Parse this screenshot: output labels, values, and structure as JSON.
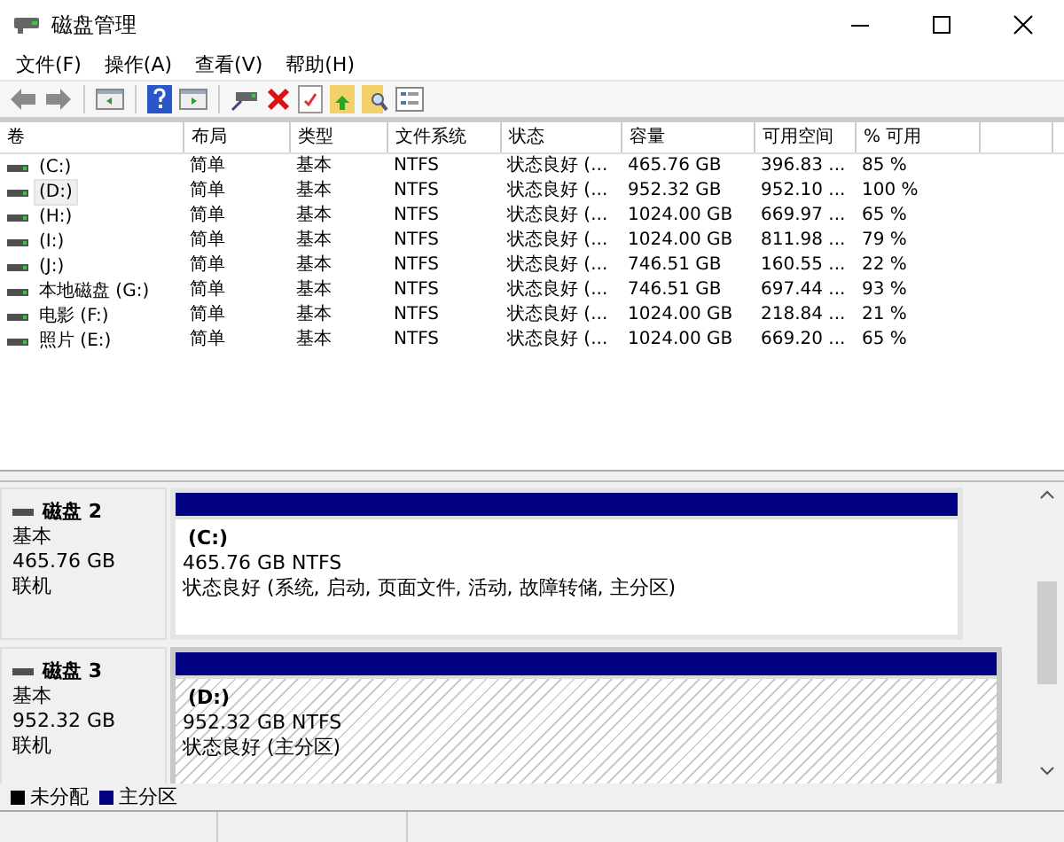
{
  "window": {
    "title": "磁盘管理"
  },
  "menu": [
    "文件(F)",
    "操作(A)",
    "查看(V)",
    "帮助(H)"
  ],
  "table": {
    "columns": [
      "卷",
      "布局",
      "类型",
      "文件系统",
      "状态",
      "容量",
      "可用空间",
      "% 可用"
    ],
    "rows": [
      {
        "cells": [
          "(C:)",
          "简单",
          "基本",
          "NTFS",
          "状态良好 (...",
          "465.76 GB",
          "396.83 ...",
          "85 %"
        ],
        "selected": false
      },
      {
        "cells": [
          "(D:)",
          "简单",
          "基本",
          "NTFS",
          "状态良好 (...",
          "952.32 GB",
          "952.10 ...",
          "100 %"
        ],
        "selected": true
      },
      {
        "cells": [
          "(H:)",
          "简单",
          "基本",
          "NTFS",
          "状态良好 (...",
          "1024.00 GB",
          "669.97 ...",
          "65 %"
        ],
        "selected": false
      },
      {
        "cells": [
          "(I:)",
          "简单",
          "基本",
          "NTFS",
          "状态良好 (...",
          "1024.00 GB",
          "811.98 ...",
          "79 %"
        ],
        "selected": false
      },
      {
        "cells": [
          "(J:)",
          "简单",
          "基本",
          "NTFS",
          "状态良好 (...",
          "746.51 GB",
          "160.55 ...",
          "22 %"
        ],
        "selected": false
      },
      {
        "cells": [
          "本地磁盘 (G:)",
          "简单",
          "基本",
          "NTFS",
          "状态良好 (...",
          "746.51 GB",
          "697.44 ...",
          "93 %"
        ],
        "selected": false
      },
      {
        "cells": [
          "电影 (F:)",
          "简单",
          "基本",
          "NTFS",
          "状态良好 (...",
          "1024.00 GB",
          "218.84 ...",
          "21 %"
        ],
        "selected": false
      },
      {
        "cells": [
          "照片 (E:)",
          "简单",
          "基本",
          "NTFS",
          "状态良好 (...",
          "1024.00 GB",
          "669.20 ...",
          "65 %"
        ],
        "selected": false
      }
    ]
  },
  "disks": [
    {
      "name": "磁盘 2",
      "type": "基本",
      "size": "465.76 GB",
      "status": "联机",
      "partitions": [
        {
          "label": "(C:)",
          "size": "465.76 GB NTFS",
          "status": "状态良好 (系统, 启动, 页面文件, 活动, 故障转储, 主分区)",
          "selected": false
        }
      ]
    },
    {
      "name": "磁盘 3",
      "type": "基本",
      "size": "952.32 GB",
      "status": "联机",
      "partitions": [
        {
          "label": "(D:)",
          "size": "952.32 GB NTFS",
          "status": "状态良好 (主分区)",
          "selected": true
        }
      ]
    }
  ],
  "legend": [
    {
      "label": "未分配",
      "color": "#000000"
    },
    {
      "label": "主分区",
      "color": "#000080"
    }
  ]
}
